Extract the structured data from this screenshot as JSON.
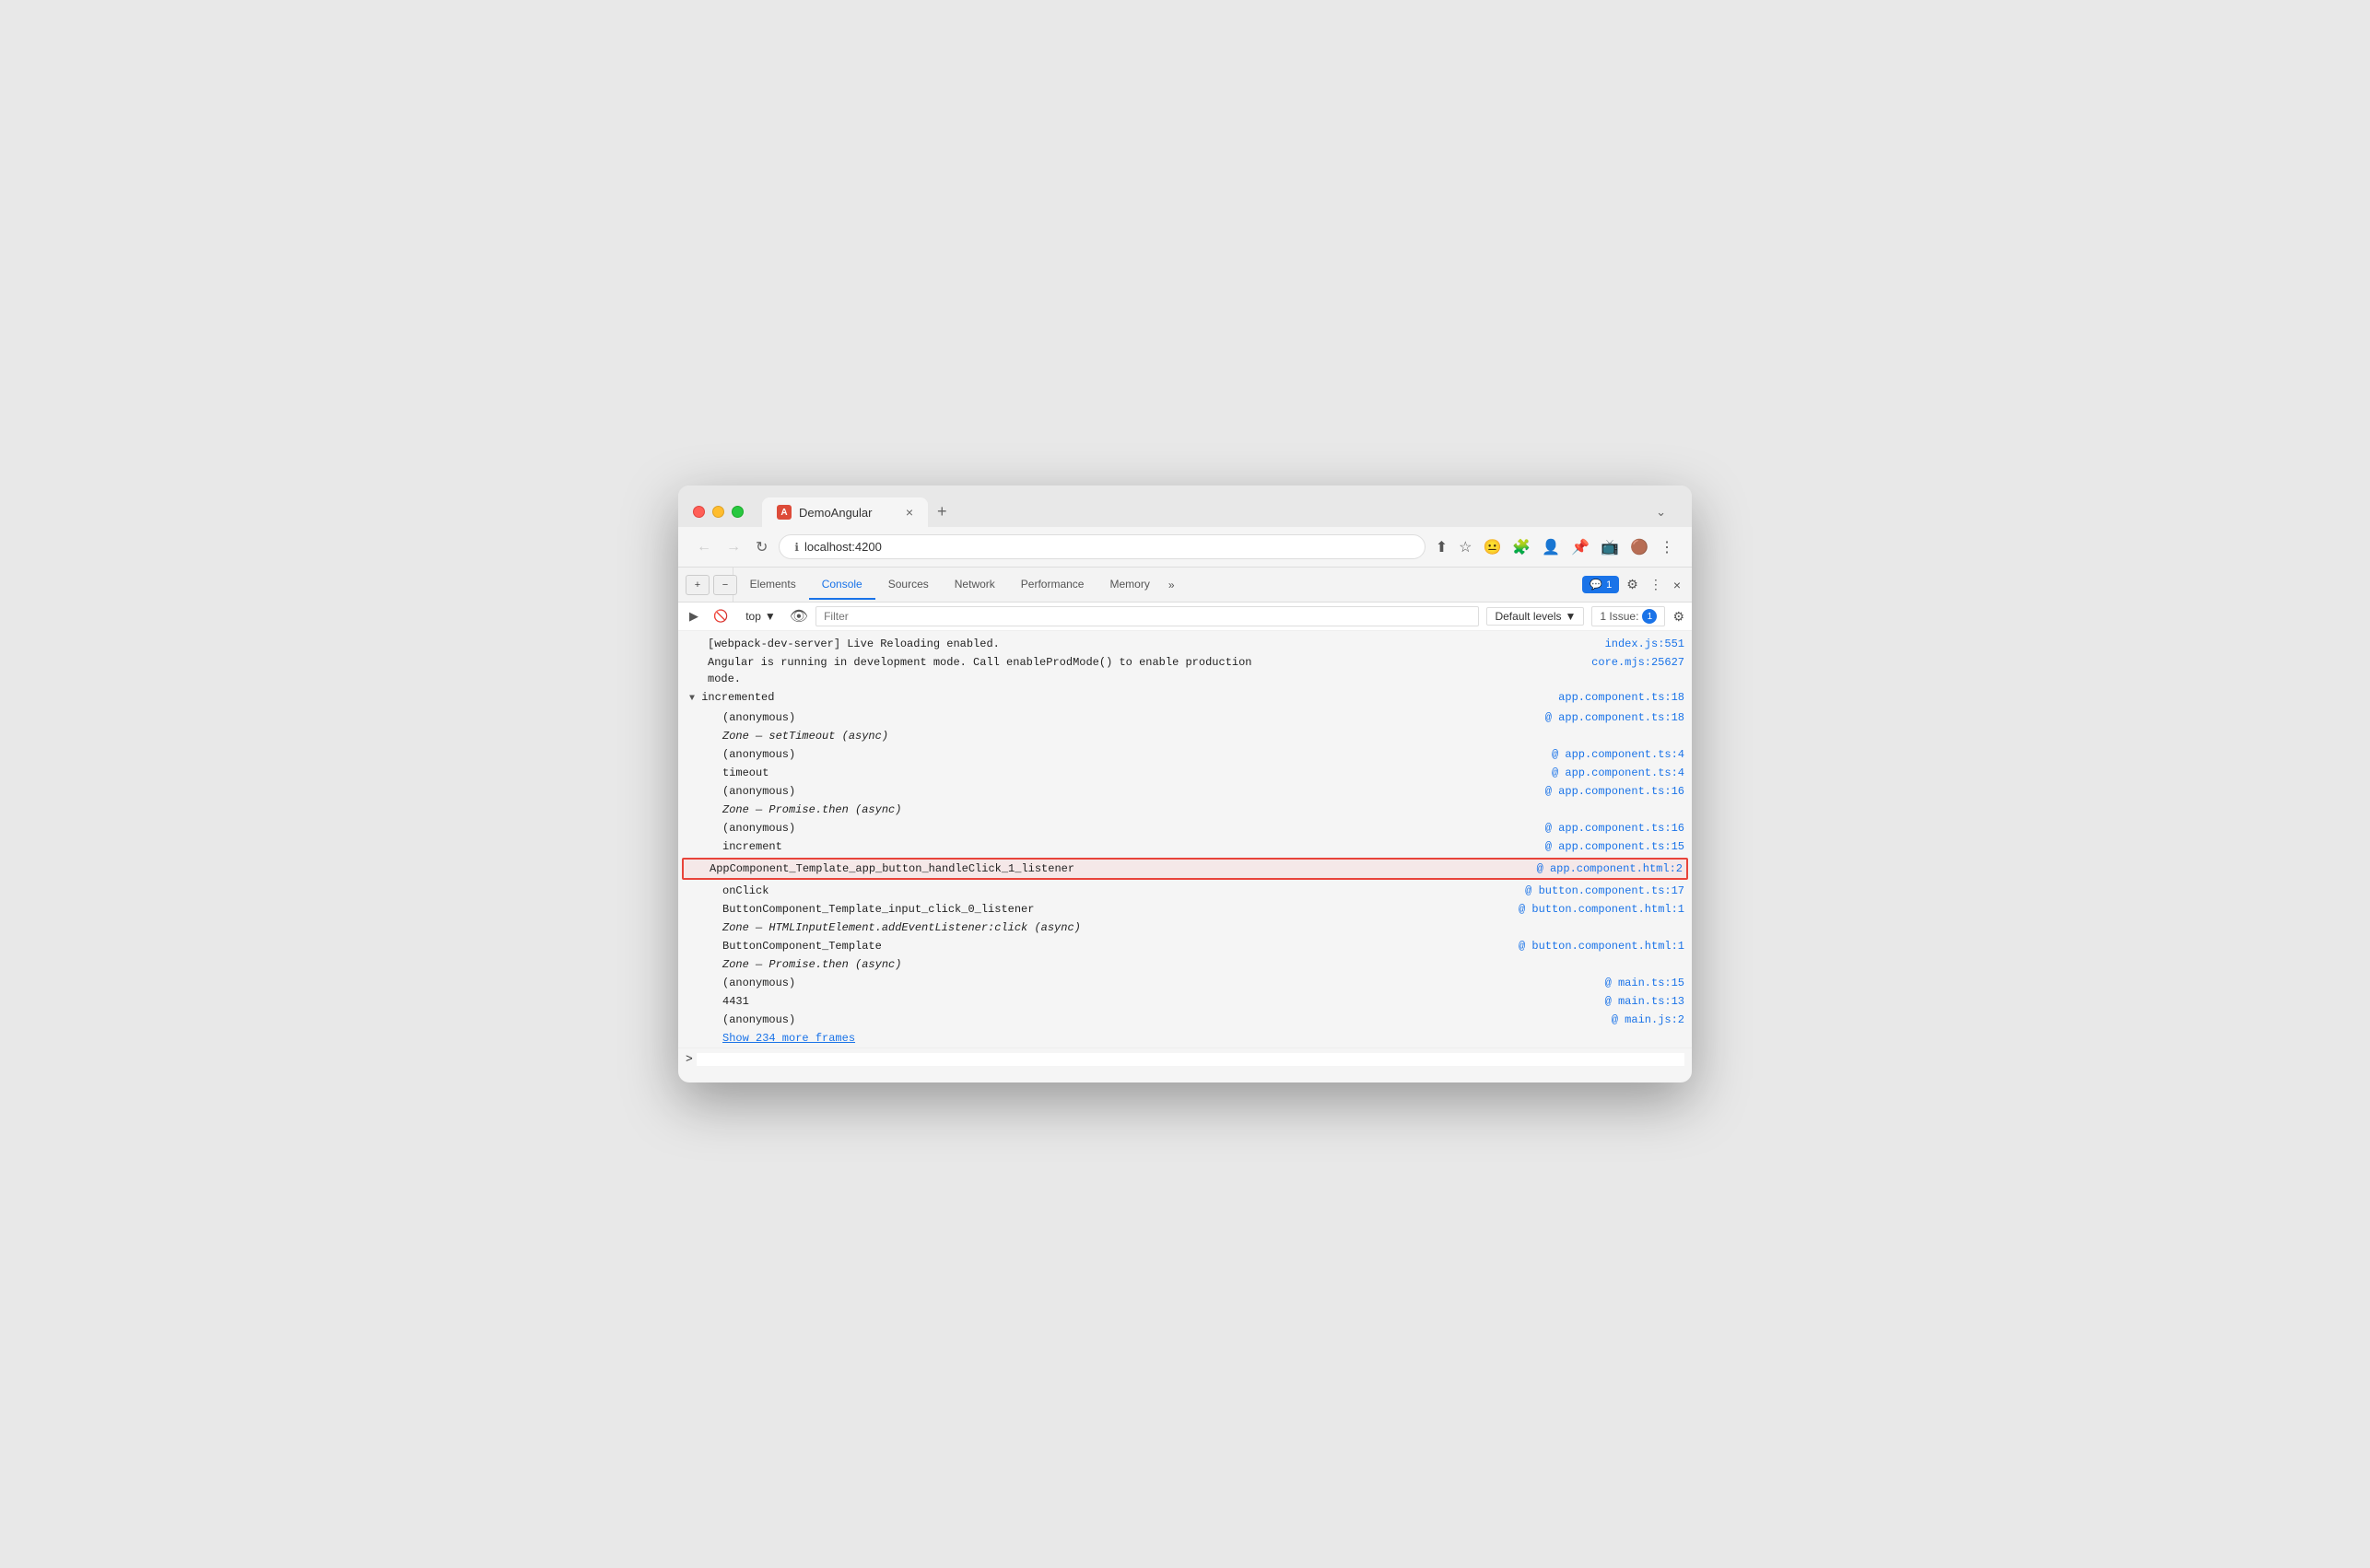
{
  "browser": {
    "tab_title": "DemoAngular",
    "tab_favicon": "A",
    "url": "localhost:4200",
    "close_tab": "×",
    "new_tab": "+",
    "tab_end_arrow": "⌄"
  },
  "nav": {
    "back": "←",
    "forward": "→",
    "reload": "↻",
    "more": "⋮"
  },
  "devtools": {
    "tabs": [
      "Elements",
      "Console",
      "Sources",
      "Network",
      "Performance",
      "Memory"
    ],
    "active_tab": "Console",
    "more_tabs": "»",
    "notification_label": "1",
    "settings_icon": "⚙",
    "more_icon": "⋮",
    "close_icon": "×"
  },
  "console_toolbar": {
    "execute_icon": "▶",
    "clear_icon": "🚫",
    "context": "top",
    "eye_icon": "👁",
    "filter_placeholder": "Filter",
    "default_levels": "Default levels",
    "issues_label": "1 Issue:",
    "issues_count": "1",
    "settings_icon": "⚙"
  },
  "console_output": {
    "lines": [
      {
        "text": "[webpack-dev-server] Live Reloading enabled.",
        "link": "index.js:551",
        "indent": false
      },
      {
        "text": "Angular is running in development mode. Call enableProdMode() to enable production\nmode.",
        "link": "core.mjs:25627",
        "indent": false
      },
      {
        "text": "▼ incremented",
        "link": "app.component.ts:18",
        "indent": false,
        "has_triangle": true
      },
      {
        "text": "    (anonymous)",
        "link": "app.component.ts:18",
        "indent": true,
        "at_prefix": true
      },
      {
        "text": "    Zone — setTimeout (async)",
        "link": "",
        "indent": true
      },
      {
        "text": "    (anonymous)",
        "link": "app.component.ts:4",
        "indent": true,
        "at_prefix": true
      },
      {
        "text": "    timeout",
        "link": "app.component.ts:4",
        "indent": true,
        "at_prefix": true
      },
      {
        "text": "    (anonymous)",
        "link": "app.component.ts:16",
        "indent": true,
        "at_prefix": true
      },
      {
        "text": "    Zone — Promise.then (async)",
        "link": "",
        "indent": true
      },
      {
        "text": "    (anonymous)",
        "link": "app.component.ts:16",
        "indent": true,
        "at_prefix": true
      },
      {
        "text": "    increment",
        "link": "app.component.ts:15",
        "indent": true,
        "at_prefix": true
      },
      {
        "text": "    AppComponent_Template_app_button_handleClick_1_listener",
        "link": "app.component.html:2",
        "indent": true,
        "at_prefix": true,
        "highlighted": true
      },
      {
        "text": "    onClick",
        "link": "button.component.ts:17",
        "indent": true,
        "at_prefix": true
      },
      {
        "text": "    ButtonComponent_Template_input_click_0_listener",
        "link": "button.component.html:1",
        "indent": true,
        "at_prefix": true
      },
      {
        "text": "    Zone — HTMLInputElement.addEventListener:click (async)",
        "link": "",
        "indent": true
      },
      {
        "text": "    ButtonComponent_Template",
        "link": "button.component.html:1",
        "indent": true,
        "at_prefix": true
      },
      {
        "text": "    Zone — Promise.then (async)",
        "link": "",
        "indent": true
      },
      {
        "text": "    (anonymous)",
        "link": "main.ts:15",
        "indent": true,
        "at_prefix": true
      },
      {
        "text": "    4431",
        "link": "main.ts:13",
        "indent": true,
        "at_prefix": true
      },
      {
        "text": "    (anonymous)",
        "link": "main.js:2",
        "indent": true,
        "at_prefix": true
      }
    ],
    "show_more_frames": "Show 234 more frames",
    "prompt_arrow": ">"
  }
}
